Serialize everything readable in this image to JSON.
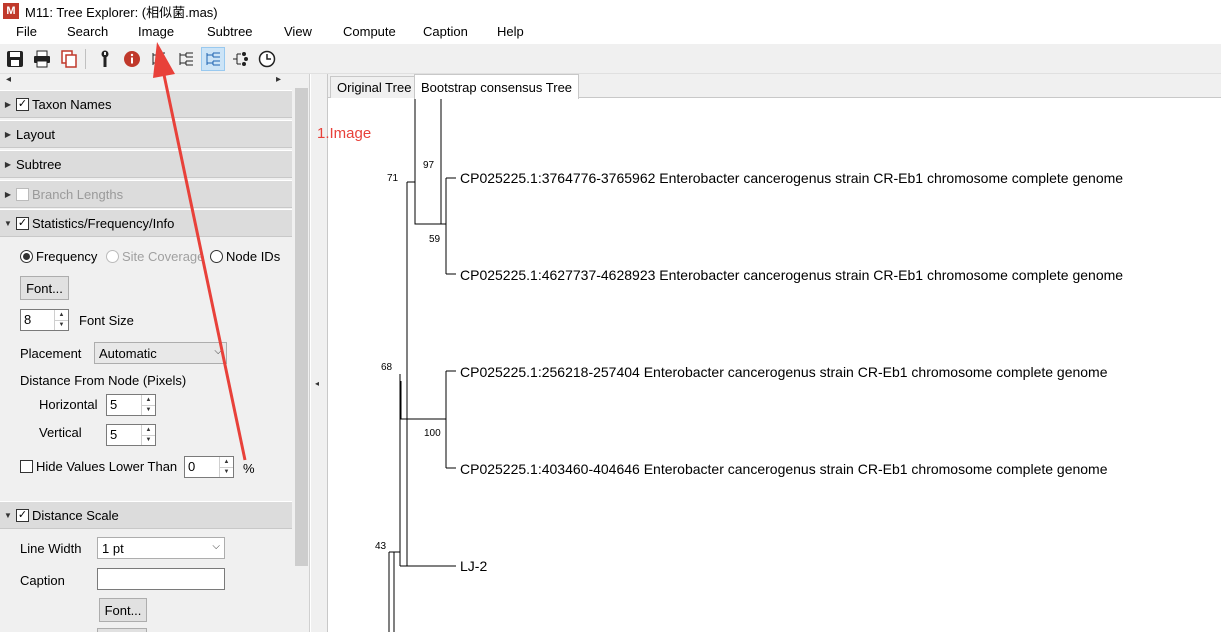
{
  "window": {
    "title": "M11: Tree Explorer: (相似菌.mas)",
    "icon": "mega-app-icon"
  },
  "menu": {
    "items": [
      "File",
      "Search",
      "Image",
      "Subtree",
      "View",
      "Compute",
      "Caption",
      "Help"
    ]
  },
  "toolbar": {
    "icons": [
      "save-icon",
      "print-icon",
      "copy-icon",
      "wrench-icon",
      "info-icon",
      "tree-icon",
      "tree-icon",
      "tree-icon",
      "tree-icon",
      "tree-icon",
      "clock-icon"
    ]
  },
  "panel": {
    "sections": {
      "taxon_names": {
        "label": "Taxon Names",
        "checked": true
      },
      "layout": {
        "label": "Layout"
      },
      "subtree": {
        "label": "Subtree"
      },
      "branch_lengths": {
        "label": "Branch Lengths",
        "checked": false,
        "disabled": true
      },
      "stats": {
        "label": "Statistics/Frequency/Info",
        "checked": true
      },
      "distance_scale": {
        "label": "Distance Scale",
        "checked": true
      }
    },
    "stats": {
      "radio_frequency": "Frequency",
      "radio_site_coverage": "Site Coverage",
      "radio_node_ids": "Node IDs",
      "font_button": "Font...",
      "font_size_value": "8",
      "font_size_label": "Font Size",
      "placement_label": "Placement",
      "placement_value": "Automatic",
      "distance_label": "Distance From Node (Pixels)",
      "horizontal_label": "Horizontal",
      "horizontal_value": "5",
      "vertical_label": "Vertical",
      "vertical_value": "5",
      "hide_values_label": "Hide Values Lower Than",
      "hide_values_value": "0",
      "percent": "%"
    },
    "distance_scale": {
      "line_width_label": "Line Width",
      "line_width_value": "1 pt",
      "caption_label": "Caption",
      "caption_value": "",
      "font_button": "Font..."
    }
  },
  "tabs": {
    "original": "Original Tree",
    "bootstrap": "Bootstrap consensus Tree",
    "active": "bootstrap"
  },
  "tree": {
    "taxa": [
      "CP025225.1:3764776-3765962 Enterobacter cancerogenus strain CR-Eb1 chromosome complete genome",
      "CP025225.1:4627737-4628923 Enterobacter cancerogenus strain CR-Eb1 chromosome complete genome",
      "CP025225.1:256218-257404 Enterobacter cancerogenus strain CR-Eb1 chromosome complete genome",
      "CP025225.1:403460-404646 Enterobacter cancerogenus strain CR-Eb1 chromosome complete genome",
      "LJ-2"
    ],
    "bootstrap_values": [
      "97",
      "71",
      "59",
      "68",
      "100",
      "43"
    ]
  },
  "annotation": {
    "text": "1.Image",
    "color": "#e8413a"
  }
}
